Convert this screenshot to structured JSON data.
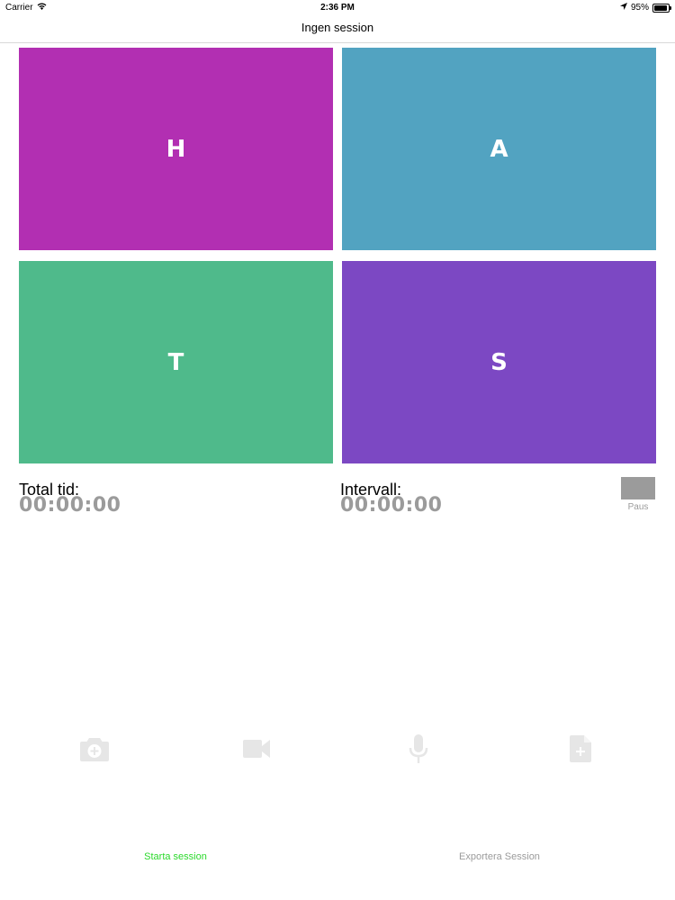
{
  "status_bar": {
    "carrier": "Carrier",
    "time": "2:36 PM",
    "battery": "95%",
    "battery_level": 0.95,
    "icons": [
      "wifi-icon",
      "location-arrow-icon",
      "battery-icon"
    ]
  },
  "nav": {
    "title": "Ingen session"
  },
  "tiles": [
    {
      "label": "H",
      "color": "#b22fb2"
    },
    {
      "label": "A",
      "color": "#52a3c1"
    },
    {
      "label": "T",
      "color": "#4fba8b"
    },
    {
      "label": "S",
      "color": "#7c48c3"
    }
  ],
  "timers": {
    "total_label": "Total tid:",
    "total_value": "00:00:00",
    "interval_label": "Intervall:",
    "interval_value": "00:00:00"
  },
  "pause": {
    "label": "Paus",
    "color": "#9b9b9b"
  },
  "toolbar_icons": [
    "camera-icon",
    "video-camera-icon",
    "microphone-icon",
    "add-document-icon"
  ],
  "icon_color": "#e6e6e6",
  "actions": {
    "start_label": "Starta session",
    "start_color": "#2bd92b",
    "export_label": "Exportera Session",
    "export_color": "#9b9b9b"
  }
}
